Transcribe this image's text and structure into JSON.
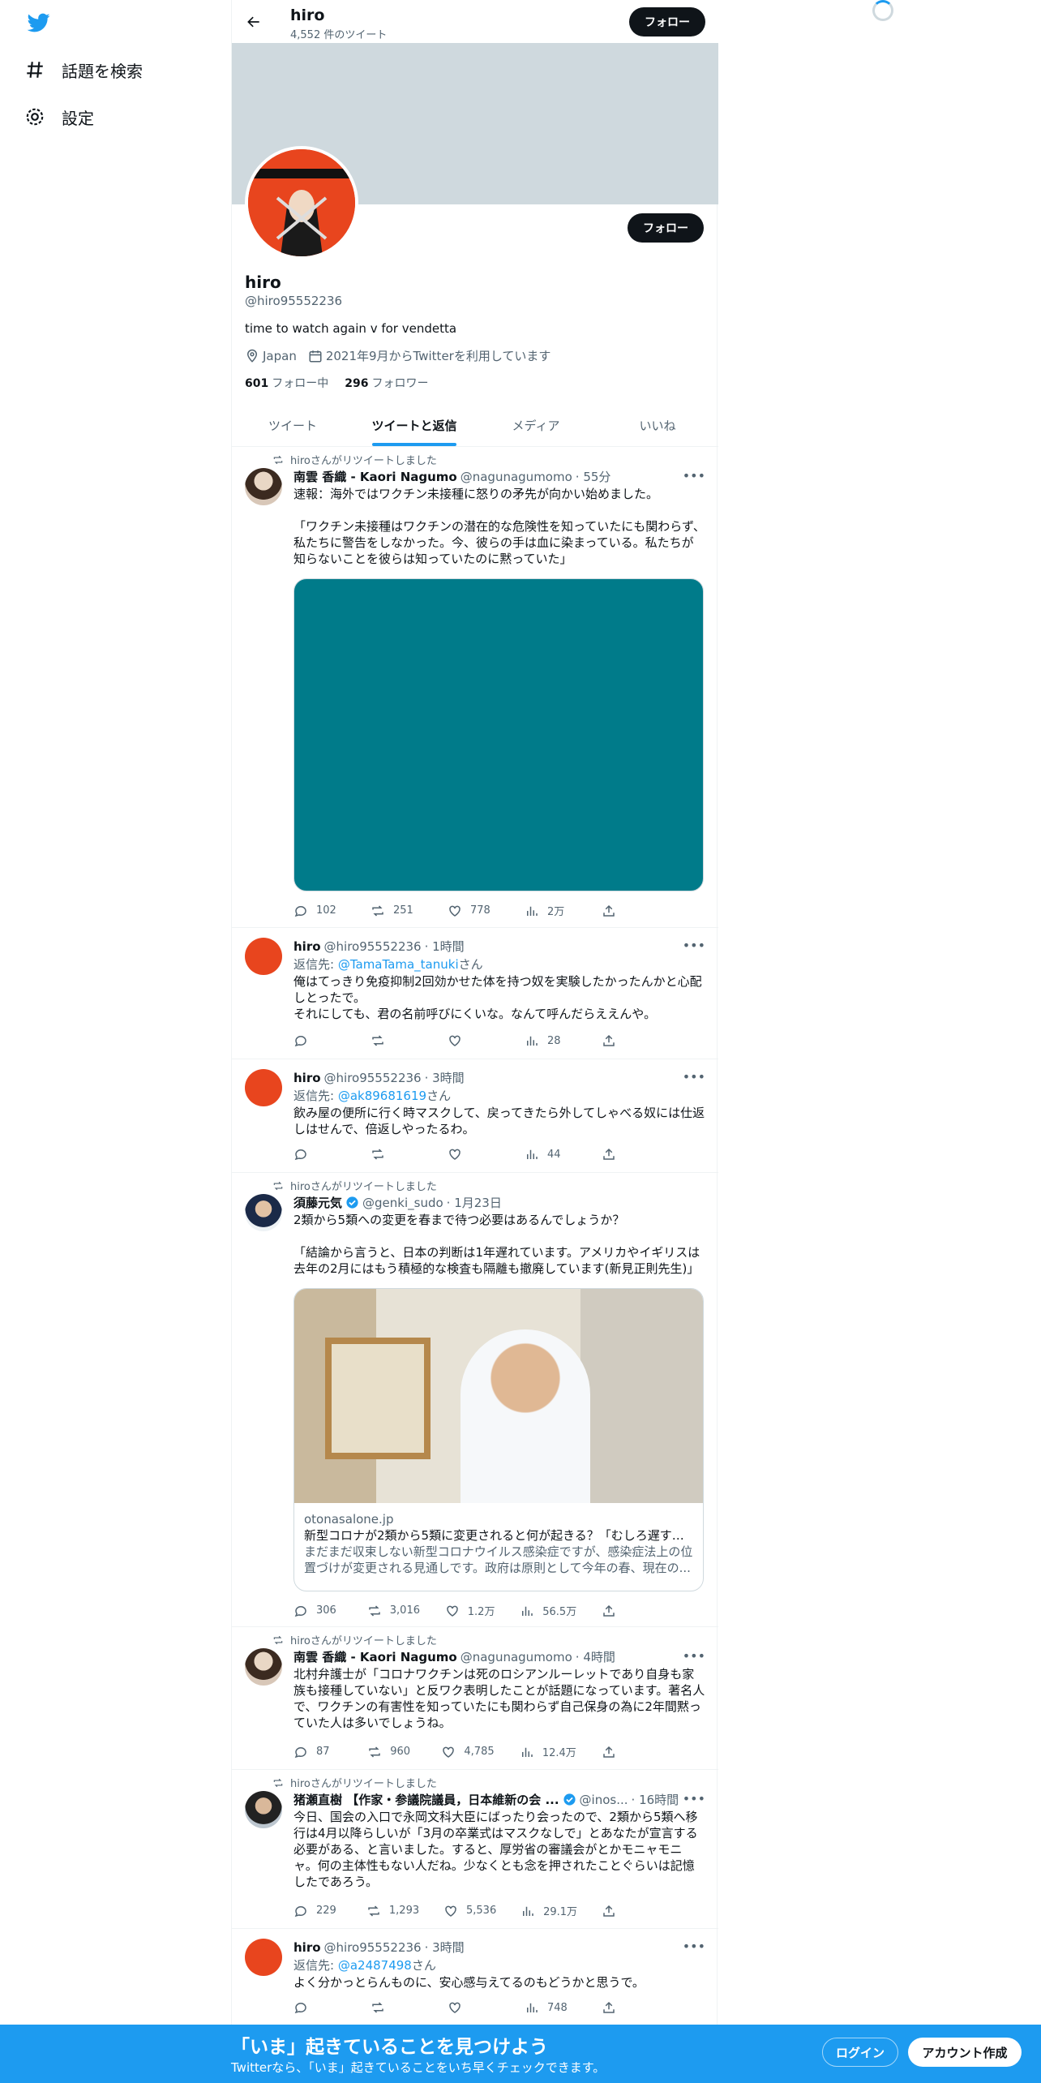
{
  "nav": {
    "explore_label": "話題を検索",
    "settings_label": "設定"
  },
  "header": {
    "name": "hiro",
    "tweet_count": "4,552 件のツイート",
    "follow_label": "フォロー"
  },
  "profile": {
    "name": "hiro",
    "handle": "@hiro95552236",
    "bio": "time to watch again v for vendetta",
    "location": "Japan",
    "joined": "2021年9月からTwitterを利用しています",
    "following_count": "601",
    "following_label": "フォロー中",
    "followers_count": "296",
    "followers_label": "フォロワー",
    "follow_label": "フォロー"
  },
  "tabs": [
    {
      "label": "ツイート"
    },
    {
      "label": "ツイートと返信"
    },
    {
      "label": "メディア"
    },
    {
      "label": "いいね"
    }
  ],
  "tweets": [
    {
      "retweet_label": "hiroさんがリツイートしました",
      "name": "南雲 香織 - Kaori Nagumo",
      "handle": "@nagunagumomo",
      "time": "· 55分",
      "text": "速報：海外ではワクチン未接種に怒りの矛先が向かい始めました。\n\n「ワクチン未接種はワクチンの潜在的な危険性を知っていたにも関わらず、私たちに警告をしなかった。今、彼らの手は血に染まっている。私たちが知らないことを彼らは知っていたのに黙っていた」",
      "media_color": "#007b8a",
      "replies": "102",
      "retweets": "251",
      "likes": "778",
      "views": "2万"
    },
    {
      "name": "hiro",
      "handle": "@hiro95552236",
      "time": "· 1時間",
      "reply_prefix": "返信先: ",
      "reply_to": "@TamaTama_tanuki",
      "reply_suffix": "さん",
      "text": "俺はてっきり免疫抑制2回効かせた体を持つ奴を実験したかったんかと心配しとったで。\nそれにしても、君の名前呼びにくいな。なんて呼んだらええんや。",
      "replies": "",
      "retweets": "",
      "likes": "",
      "views": "28"
    },
    {
      "name": "hiro",
      "handle": "@hiro95552236",
      "time": "· 3時間",
      "reply_prefix": "返信先: ",
      "reply_to": "@ak89681619",
      "reply_suffix": "さん",
      "text": "飲み屋の便所に行く時マスクして、戻ってきたら外してしゃべる奴には仕返しはせんで、倍返しやったるわ。",
      "replies": "",
      "retweets": "",
      "likes": "",
      "views": "44"
    },
    {
      "retweet_label": "hiroさんがリツイートしました",
      "name": "須藤元気",
      "handle": "@genki_sudo",
      "time": "· 1月23日",
      "text": "2類から5類への変更を春まで待つ必要はあるんでしょうか？\n\n「結論から言うと、日本の判断は1年遅れています。アメリカやイギリスは去年の2月にはもう積極的な検査も隔離も撤廃しています(新見正則先生)」",
      "card": {
        "domain": "otonasalone.jp",
        "title": "新型コロナが2類から5類に変更されると何が起きる？「むしろ遅すぎ...",
        "description": "まだまだ収束しない新型コロナウイルス感染症ですが、感染症法上の位置づけが変更される見通しです。政府は原則として今年の春、現在の..."
      },
      "replies": "306",
      "retweets": "3,016",
      "likes": "1.2万",
      "views": "56.5万"
    },
    {
      "retweet_label": "hiroさんがリツイートしました",
      "name": "南雲 香織 - Kaori Nagumo",
      "handle": "@nagunagumomo",
      "time": "· 4時間",
      "text": "北村弁護士が「コロナワクチンは死のロシアンルーレットであり自身も家族も接種していない」と反ワク表明したことが話題になっています。著名人で、ワクチンの有害性を知っていたにも関わらず自己保身の為に2年間黙っていた人は多いでしょうね。",
      "replies": "87",
      "retweets": "960",
      "likes": "4,785",
      "views": "12.4万"
    },
    {
      "retweet_label": "hiroさんがリツイートしました",
      "name": "猪瀬直樹 【作家・参議院議員，日本維新の会 ...",
      "handle": "@inos...",
      "time": "· 16時間",
      "text": "今日、国会の入口で永岡文科大臣にばったり会ったので、2類から5類へ移行は4月以降らしいが「3月の卒業式はマスクなしで」とあなたが宣言する必要がある、と言いました。すると、厚労省の審議会がとかモニャモニャ。何の主体性もない人だね。少なくとも念を押されたことぐらいは記憶したであろう。",
      "replies": "229",
      "retweets": "1,293",
      "likes": "5,536",
      "views": "29.1万"
    },
    {
      "name": "hiro",
      "handle": "@hiro95552236",
      "time": "· 3時間",
      "reply_prefix": "返信先: ",
      "reply_to": "@a2487498",
      "reply_suffix": "さん",
      "text": "よく分かっとらんものに、安心感与えてるのもどうかと思うで。",
      "replies": "",
      "retweets": "",
      "likes": "",
      "views": "748"
    }
  ],
  "bottombar": {
    "title": "「いま」起きていることを見つけよう",
    "subtitle": "Twitterなら、「いま」起きていることをいち早くチェックできます。",
    "login_label": "ログイン",
    "signup_label": "アカウント作成"
  },
  "colors": {
    "accent": "#1d9bf0",
    "media_teal": "#007b8a"
  }
}
